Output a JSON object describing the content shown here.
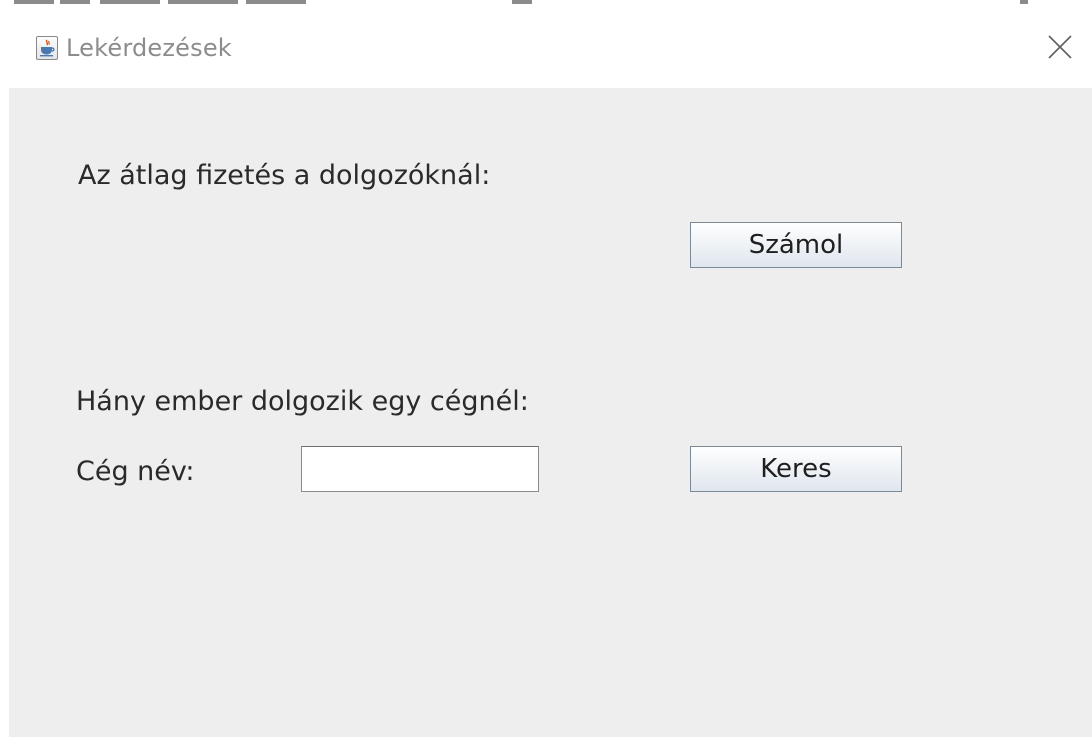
{
  "window": {
    "title": "Lekérdezések",
    "icon": "java-coffee-cup-icon",
    "close_icon": "close-icon"
  },
  "average_salary": {
    "label": "Az átlag fizetés a dolgozóknál:",
    "button_label": "Számol"
  },
  "employee_count": {
    "label": "Hány ember dolgozik egy cégnél:",
    "company_name_label": "Cég név:",
    "company_name_value": "",
    "button_label": "Keres"
  },
  "colors": {
    "content_background": "#eeeeee",
    "titlebar_background": "#ffffff",
    "title_text": "#8c8c8c",
    "button_border": "#7a8a99"
  }
}
